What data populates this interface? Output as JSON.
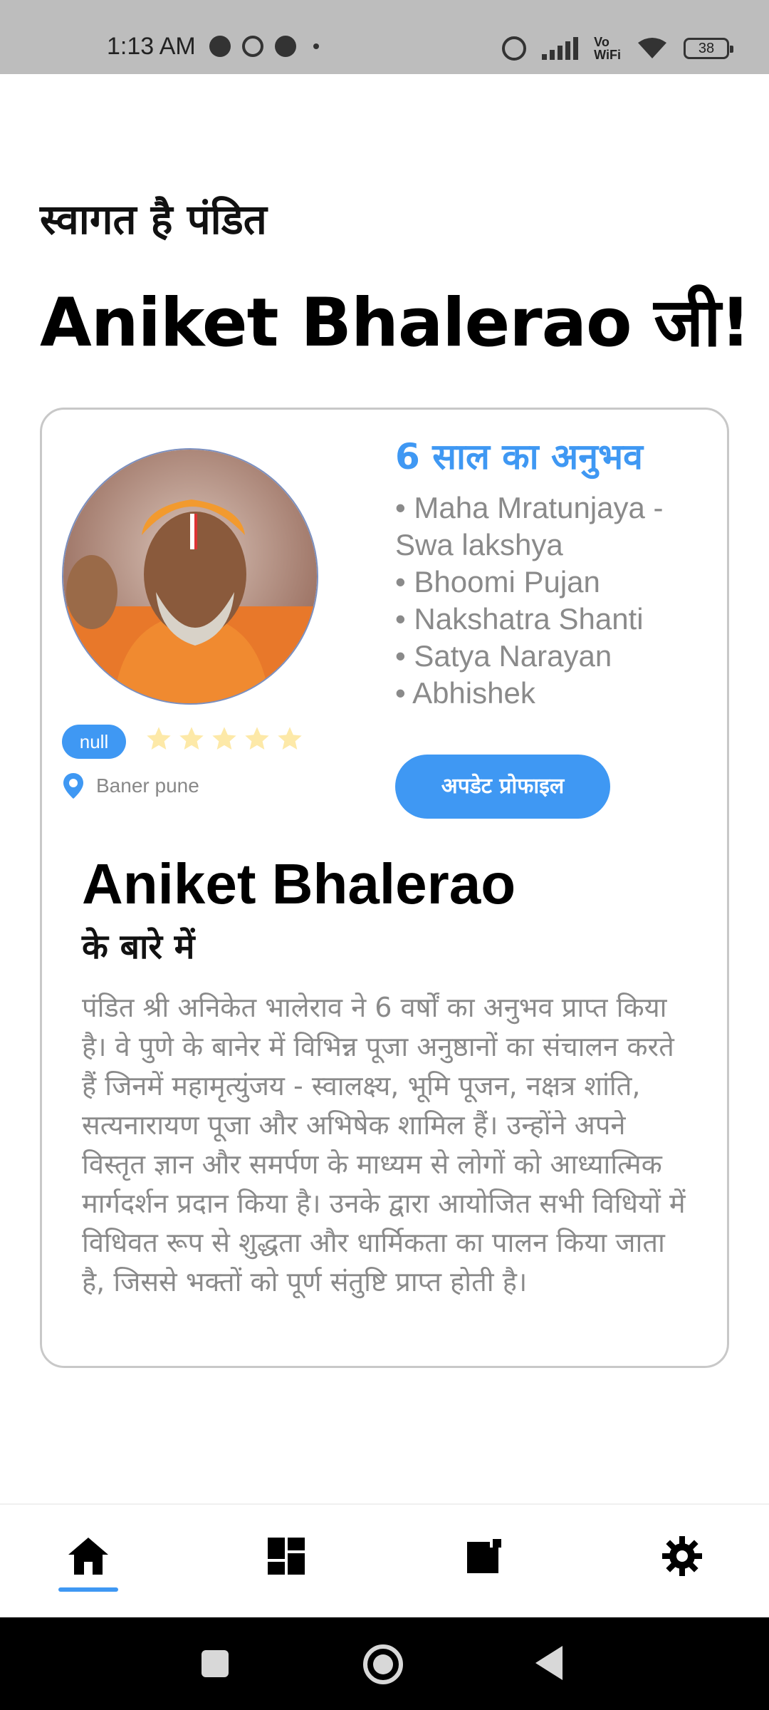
{
  "status_bar": {
    "time": "1:13 AM",
    "vowifi": "Vo\nWiFi",
    "battery": "38"
  },
  "greeting": {
    "line1": "स्वागत है पंडित",
    "line2": "Aniket Bhalerao जी!"
  },
  "profile_card": {
    "experience": "6 साल का अनुभव",
    "services": [
      "Maha Mratunjaya - Swa lakshya",
      "Bhoomi Pujan",
      "Nakshatra Shanti",
      "Satya Narayan",
      "Abhishek"
    ],
    "rating_badge": "null",
    "stars": 5,
    "star_color": "#fde9a8",
    "location": "Baner pune",
    "update_button": "अपडेट प्रोफाइल",
    "about_name": "Aniket Bhalerao",
    "about_subtitle": "के बारे में",
    "about_text": "पंडित श्री अनिकेत भालेराव ने 6 वर्षों का अनुभव प्राप्त किया है। वे पुणे के बानेर में विभिन्न पूजा अनुष्ठानों का संचालन करते हैं जिनमें महामृत्युंजय - स्वालक्ष्य, भूमि पूजन, नक्षत्र शांति, सत्यनारायण पूजा और अभिषेक शामिल हैं। उन्होंने अपने विस्तृत ज्ञान और समर्पण के माध्यम से लोगों को आध्यात्मिक मार्गदर्शन प्रदान किया है। उनके द्वारा आयोजित सभी विधियों में विधिवत रूप से शुद्धता और धार्मिकता का पालन किया जाता है, जिससे भक्तों को पूर्ण संतुष्टि प्राप्त होती है।"
  },
  "bottom_nav": {
    "items": [
      "home-icon",
      "dashboard-icon",
      "bookings-icon",
      "settings-icon"
    ],
    "active": "home-icon",
    "accent": "#3f98f3"
  }
}
